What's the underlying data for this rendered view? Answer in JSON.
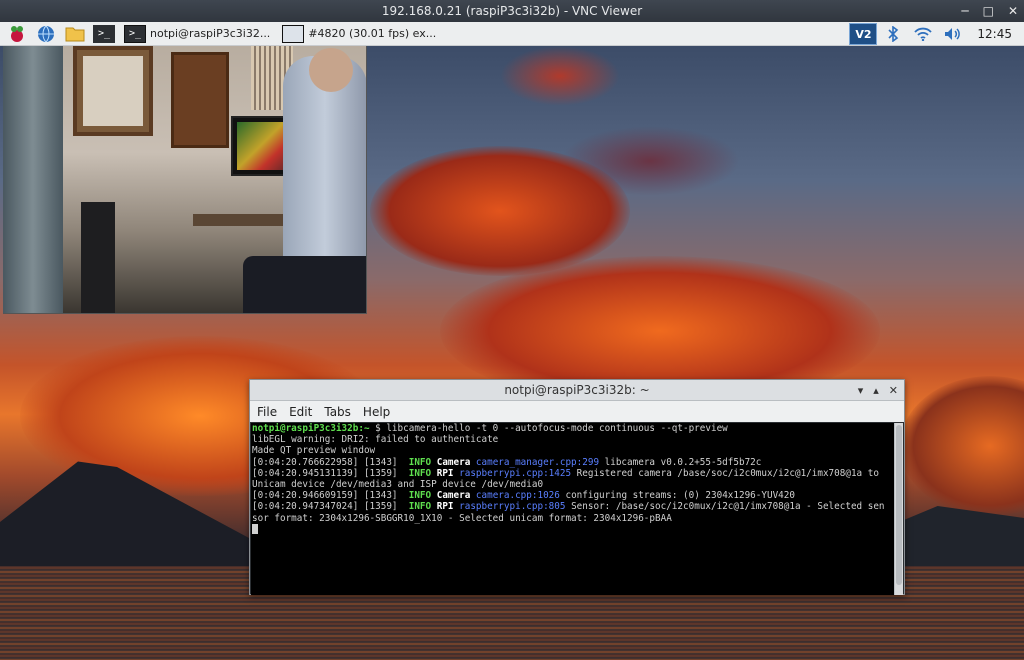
{
  "vnc": {
    "title": "192.168.0.21 (raspiP3c3i32b) - VNC Viewer",
    "min": "─",
    "max": "□",
    "close": "✕"
  },
  "taskbar": {
    "tasks": [
      {
        "label": "notpi@raspiP3c3i32..."
      },
      {
        "label": "#4820 (30.01 fps) ex..."
      }
    ],
    "clock": "12:45",
    "vnc_tray_label": "V2"
  },
  "terminal": {
    "title": "notpi@raspiP3c3i32b: ~",
    "menu": [
      "File",
      "Edit",
      "Tabs",
      "Help"
    ],
    "ctrl_min": "▾",
    "ctrl_max": "▴",
    "ctrl_close": "✕",
    "lines": {
      "l1_prompt": "notpi@raspiP3c3i32b:~",
      "l1_cmd": " $ libcamera-hello -t 0 --autofocus-mode continuous --qt-preview",
      "l2": "libEGL warning: DRI2: failed to authenticate",
      "l3": "Made QT preview window",
      "l4_ts": "[0:04:20.766622958] [1343]  ",
      "l4_info": "INFO",
      "l4_cat": " Camera ",
      "l4_src": "camera_manager.cpp:299",
      "l4_msg": " libcamera v0.0.2+55-5df5b72c",
      "l5_ts": "[0:04:20.945131139] [1359]  ",
      "l5_info": "INFO",
      "l5_cat": " RPI ",
      "l5_src": "raspberrypi.cpp:1425",
      "l5_msg": " Registered camera /base/soc/i2c0mux/i2c@1/imx708@1a to",
      "l6": "Unicam device /dev/media3 and ISP device /dev/media0",
      "l7_ts": "[0:04:20.946609159] [1343]  ",
      "l7_info": "INFO",
      "l7_cat": " Camera ",
      "l7_src": "camera.cpp:1026",
      "l7_msg": " configuring streams: (0) 2304x1296-YUV420",
      "l8_ts": "[0:04:20.947347024] [1359]  ",
      "l8_info": "INFO",
      "l8_cat": " RPI ",
      "l8_src": "raspberrypi.cpp:805",
      "l8_msg": " Sensor: /base/soc/i2c0mux/i2c@1/imx708@1a - Selected sen",
      "l9": "sor format: 2304x1296-SBGGR10_1X10 - Selected unicam format: 2304x1296-pBAA"
    }
  }
}
